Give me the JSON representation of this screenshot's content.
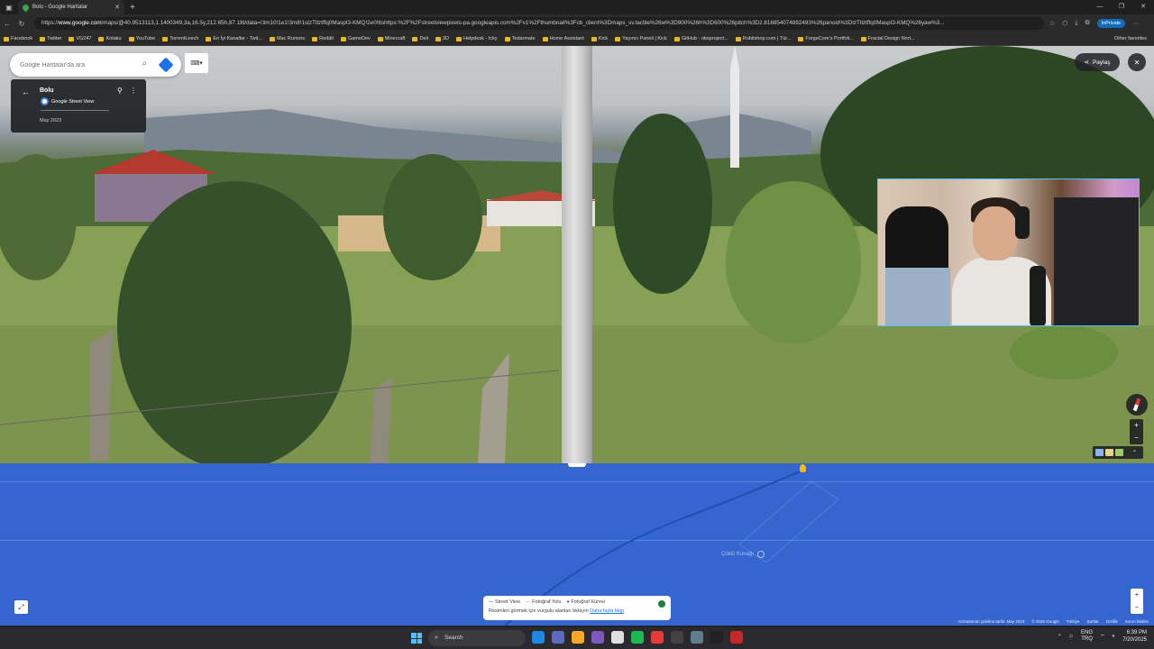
{
  "browser": {
    "tab_title": "Bolu - Google Haritalar",
    "url_prefix": "https://",
    "url_host": "www.google.com",
    "url_rest": "/maps/@40.9513113,1.1400349,3a,16.5y,212.65h,87.18t/data=!3m10!1e1!3m8!1sIzTtlztffq0MaspI3-KMQ!2e0!6shttps:%2F%2Fstreetviewpixels-pa.googleapis.com%2Fv1%2Fthumbnail%3Fcb_client%3Dmaps_sv.tactile%26w%3D900%26h%3D600%26pitch%3D2.816854074892493%26panoid%3DIzTtlztffq0MaspI3-KMQ%26yaw%3...",
    "inprivate_label": "InPrivate",
    "other_favorites": "Other favorites",
    "bookmarks": [
      "Facebook",
      "Twitter",
      "VG247",
      "Kotaku",
      "YouTube",
      "TorrentLeech",
      "En İyi Kanallar - Twit...",
      "Mac Rumors",
      "Reddit",
      "GameDev",
      "Minecraft",
      "Deli",
      "3D",
      "Helpdesk - Icky",
      "Tedarmate",
      "Home Assistant",
      "Kick",
      "Yayıncı Paneli | Kick",
      "GitHub - obsproject...",
      "Robitshop.com | Tür...",
      "ForgeCore's Portfoli...",
      "Fractal Design Nort..."
    ]
  },
  "streetview": {
    "search_placeholder": "Google Haritalar'da ara",
    "place_name": "Bolu",
    "source": "Google Street View",
    "date": "May 2023",
    "share_label": "Paylaş"
  },
  "map": {
    "poi_label": "Çöklü Konağı",
    "legend_street_view": "Street View",
    "legend_photo_path": "Fotoğraf Yolu",
    "legend_photo_sphere": "Fotoğraf Küresi",
    "legend_hint": "Resimleri görmek için vurgulu alanları tıklayın",
    "legend_link": "Daha fazla bilgi",
    "attribution": [
      "Görüntünün çekilme tarihi: May 2023",
      "© 2025 Google",
      "Türkiye",
      "Şartlar",
      "Gizlilik",
      "Sorun bildirin"
    ]
  },
  "taskbar": {
    "search_label": "Search",
    "lang_top": "ENG",
    "lang_bottom": "TRQ",
    "time": "6:39 PM",
    "date": "7/20/2025"
  },
  "colors": {
    "map_blue": "#3566d0",
    "accent": "#1a73e8",
    "webcam_border": "#4fc3f7"
  }
}
